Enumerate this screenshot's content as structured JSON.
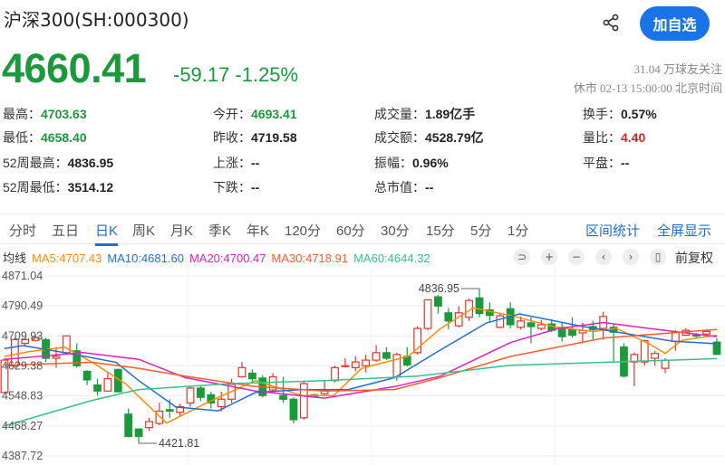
{
  "header": {
    "title": "沪深300(SH:000300)",
    "add_button": "加自选",
    "share_icon": "share-icon"
  },
  "quote": {
    "price": "4660.41",
    "change": "-59.17",
    "change_pct": "-1.25%",
    "followers": "31.04 万球友关注",
    "status": "休市 02-13 15:00:00 北京时间"
  },
  "stats": [
    {
      "label": "最高：",
      "value": "4703.63",
      "color": "green"
    },
    {
      "label": "今开：",
      "value": "4693.41",
      "color": "green"
    },
    {
      "label": "成交量：",
      "value": "1.89亿手",
      "color": ""
    },
    {
      "label": "换手：",
      "value": "0.57%",
      "color": ""
    },
    {
      "label": "最低：",
      "value": "4658.40",
      "color": "green"
    },
    {
      "label": "昨收：",
      "value": "4719.58",
      "color": ""
    },
    {
      "label": "成交额：",
      "value": "4528.79亿",
      "color": ""
    },
    {
      "label": "量比：",
      "value": "4.40",
      "color": "red"
    },
    {
      "label": "52周最高：",
      "value": "4836.95",
      "color": ""
    },
    {
      "label": "上涨：",
      "value": "--",
      "color": ""
    },
    {
      "label": "振幅：",
      "value": "0.96%",
      "color": ""
    },
    {
      "label": "平盘：",
      "value": "--",
      "color": ""
    },
    {
      "label": "52周最低：",
      "value": "3514.12",
      "color": ""
    },
    {
      "label": "下跌：",
      "value": "--",
      "color": ""
    },
    {
      "label": "总市值：",
      "value": "--",
      "color": ""
    }
  ],
  "tabs": [
    "分时",
    "五日",
    "日K",
    "周K",
    "月K",
    "季K",
    "年K",
    "120分",
    "60分",
    "30分",
    "15分",
    "5分",
    "1分"
  ],
  "active_tab": "日K",
  "tab_links": [
    "区间统计",
    "全屏显示"
  ],
  "ma_legend": {
    "label": "均线",
    "items": [
      {
        "text": "MA5:4707.43",
        "color": "#ff8c00"
      },
      {
        "text": "MA10:4681.60",
        "color": "#1e6fd9"
      },
      {
        "text": "MA20:4700.47",
        "color": "#e020c0"
      },
      {
        "text": "MA30:4718.91",
        "color": "#ff5a2a"
      },
      {
        "text": "MA60:4644.32",
        "color": "#33c38a"
      }
    ]
  },
  "controls": {
    "icons": [
      "undo-icon",
      "zoom-in-icon",
      "zoom-out-icon",
      "left-icon",
      "right-icon",
      "candle-icon"
    ],
    "glyphs": [
      "⊃",
      "+",
      "−",
      "‹",
      "›",
      "▯"
    ],
    "adjust_label": "前复权"
  },
  "colors": {
    "up": "#e8322c",
    "down": "#1a9a3a",
    "accent": "#1a73e8"
  },
  "chart_data": {
    "type": "candlestick",
    "y_ticks": [
      "4871.04",
      "4790.49",
      "4709.93",
      "4629.38",
      "4548.83",
      "4468.27",
      "4387.72"
    ],
    "ylim": [
      4387.72,
      4871.04
    ],
    "annotations": [
      {
        "text": "4836.95",
        "value": 4836.95,
        "index": 46
      },
      {
        "text": "4421.81",
        "value": 4421.81,
        "index": 13
      }
    ],
    "candles": [
      [
        4558,
        4650,
        4555,
        4645
      ],
      [
        4630,
        4705,
        4625,
        4700
      ],
      [
        4690,
        4706,
        4683,
        4700
      ],
      [
        4698,
        4712,
        4695,
        4706
      ],
      [
        4700,
        4705,
        4640,
        4650
      ],
      [
        4650,
        4680,
        4625,
        4655
      ],
      [
        4665,
        4712,
        4660,
        4710
      ],
      [
        4670,
        4690,
        4625,
        4630
      ],
      [
        4615,
        4618,
        4578,
        4592
      ],
      [
        4578,
        4595,
        4550,
        4562
      ],
      [
        4562,
        4610,
        4560,
        4595
      ],
      [
        4620,
        4622,
        4558,
        4560
      ],
      [
        4500,
        4515,
        4438,
        4440
      ],
      [
        4460,
        4462,
        4421.81,
        4440
      ],
      [
        4464,
        4490,
        4455,
        4480
      ],
      [
        4475,
        4530,
        4470,
        4508
      ],
      [
        4512,
        4540,
        4490,
        4508
      ],
      [
        4505,
        4528,
        4495,
        4520
      ],
      [
        4530,
        4575,
        4520,
        4570
      ],
      [
        4570,
        4575,
        4535,
        4545
      ],
      [
        4552,
        4560,
        4515,
        4530
      ],
      [
        4520,
        4560,
        4507,
        4540
      ],
      [
        4540,
        4595,
        4530,
        4580
      ],
      [
        4600,
        4640,
        4598,
        4625
      ],
      [
        4610,
        4620,
        4585,
        4595
      ],
      [
        4597,
        4605,
        4545,
        4550
      ],
      [
        4565,
        4610,
        4560,
        4600
      ],
      [
        4550,
        4600,
        4530,
        4540
      ],
      [
        4540,
        4545,
        4475,
        4485
      ],
      [
        4490,
        4590,
        4485,
        4582
      ],
      [
        4552,
        4555,
        4545,
        4548
      ],
      [
        4555,
        4590,
        4550,
        4565
      ],
      [
        4590,
        4630,
        4585,
        4625
      ],
      [
        4628,
        4650,
        4625,
        4630
      ],
      [
        4625,
        4655,
        4615,
        4640
      ],
      [
        4630,
        4660,
        4612,
        4645
      ],
      [
        4645,
        4685,
        4640,
        4665
      ],
      [
        4665,
        4680,
        4645,
        4650
      ],
      [
        4600,
        4665,
        4590,
        4660
      ],
      [
        4655,
        4680,
        4628,
        4632
      ],
      [
        4665,
        4735,
        4660,
        4730
      ],
      [
        4730,
        4808,
        4725,
        4807
      ],
      [
        4815,
        4820,
        4770,
        4790
      ],
      [
        4772,
        4785,
        4728,
        4750
      ],
      [
        4737,
        4790,
        4733,
        4772
      ],
      [
        4760,
        4810,
        4750,
        4805
      ],
      [
        4812,
        4836.95,
        4760,
        4770
      ],
      [
        4780,
        4800,
        4745,
        4765
      ],
      [
        4733,
        4770,
        4730,
        4764
      ],
      [
        4783,
        4800,
        4730,
        4740
      ],
      [
        4733,
        4762,
        4727,
        4750
      ],
      [
        4745,
        4760,
        4690,
        4735
      ],
      [
        4730,
        4752,
        4725,
        4740
      ],
      [
        4742,
        4755,
        4720,
        4725
      ],
      [
        4733,
        4745,
        4695,
        4708
      ],
      [
        4727,
        4760,
        4705,
        4712
      ],
      [
        4718,
        4745,
        4690,
        4725
      ],
      [
        4735,
        4750,
        4700,
        4727
      ],
      [
        4730,
        4775,
        4700,
        4762
      ],
      [
        4733,
        4740,
        4640,
        4720
      ],
      [
        4680,
        4690,
        4598,
        4602
      ],
      [
        4640,
        4665,
        4575,
        4660
      ],
      [
        4640,
        4700,
        4630,
        4697
      ],
      [
        4650,
        4670,
        4630,
        4663
      ],
      [
        4623,
        4650,
        4610,
        4645
      ],
      [
        4695,
        4725,
        4670,
        4720
      ],
      [
        4712,
        4731,
        4710,
        4725
      ],
      [
        4712,
        4718,
        4705,
        4710
      ],
      [
        4715,
        4728,
        4710,
        4722
      ],
      [
        4693.41,
        4703.63,
        4658.4,
        4660.41
      ]
    ],
    "candle_fields": [
      "open",
      "high",
      "low",
      "close"
    ],
    "ma_series": [
      {
        "name": "MA5",
        "color": "#ff8c00",
        "points": [
          [
            0,
            4655
          ],
          [
            2.2,
            4667
          ],
          [
            5.8,
            4680
          ],
          [
            8.5,
            4639
          ],
          [
            11.7,
            4582
          ],
          [
            15.7,
            4476
          ],
          [
            19.8,
            4533
          ],
          [
            24.3,
            4590
          ],
          [
            28.8,
            4550
          ],
          [
            31.9,
            4550
          ],
          [
            34.6,
            4623
          ],
          [
            39.1,
            4655
          ],
          [
            42.2,
            4729
          ],
          [
            45.4,
            4785
          ],
          [
            49,
            4765
          ],
          [
            53.5,
            4733
          ],
          [
            57,
            4722
          ],
          [
            59.3,
            4730
          ],
          [
            62.5,
            4688
          ],
          [
            64,
            4663
          ],
          [
            65.6,
            4698
          ],
          [
            69,
            4712
          ]
        ]
      },
      {
        "name": "MA10",
        "color": "#1e6fd9",
        "points": [
          [
            0,
            4676
          ],
          [
            1.8,
            4684
          ],
          [
            6.3,
            4663
          ],
          [
            10.8,
            4639
          ],
          [
            13,
            4590
          ],
          [
            16.6,
            4519
          ],
          [
            20.7,
            4509
          ],
          [
            24.3,
            4558
          ],
          [
            28.8,
            4566
          ],
          [
            33.3,
            4566
          ],
          [
            37.8,
            4598
          ],
          [
            42.2,
            4672
          ],
          [
            46.7,
            4745
          ],
          [
            49.9,
            4769
          ],
          [
            55.7,
            4737
          ],
          [
            60.2,
            4716
          ],
          [
            64.7,
            4696
          ],
          [
            69,
            4689
          ]
        ]
      },
      {
        "name": "MA20",
        "color": "#e020c0",
        "points": [
          [
            0,
            4647
          ],
          [
            7.6,
            4665
          ],
          [
            13,
            4647
          ],
          [
            17.5,
            4598
          ],
          [
            24.3,
            4562
          ],
          [
            31,
            4543
          ],
          [
            37.8,
            4574
          ],
          [
            42.2,
            4602
          ],
          [
            49,
            4692
          ],
          [
            53.5,
            4729
          ],
          [
            58,
            4746
          ],
          [
            62.5,
            4730
          ],
          [
            69,
            4708
          ]
        ]
      },
      {
        "name": "MA30",
        "color": "#ff5a2a",
        "points": [
          [
            0,
            4631
          ],
          [
            8.5,
            4639
          ],
          [
            13,
            4623
          ],
          [
            17.5,
            4602
          ],
          [
            24.3,
            4574
          ],
          [
            31,
            4562
          ],
          [
            37.8,
            4566
          ],
          [
            42.2,
            4598
          ],
          [
            49,
            4655
          ],
          [
            58,
            4704
          ],
          [
            62.5,
            4714
          ],
          [
            69,
            4727
          ]
        ]
      },
      {
        "name": "MA60",
        "color": "#33c38a",
        "points": [
          [
            0,
            4468
          ],
          [
            8.5,
            4537
          ],
          [
            13,
            4566
          ],
          [
            22,
            4582
          ],
          [
            31,
            4590
          ],
          [
            40,
            4602
          ],
          [
            49,
            4631
          ],
          [
            58,
            4639
          ],
          [
            69,
            4649
          ]
        ]
      }
    ]
  }
}
